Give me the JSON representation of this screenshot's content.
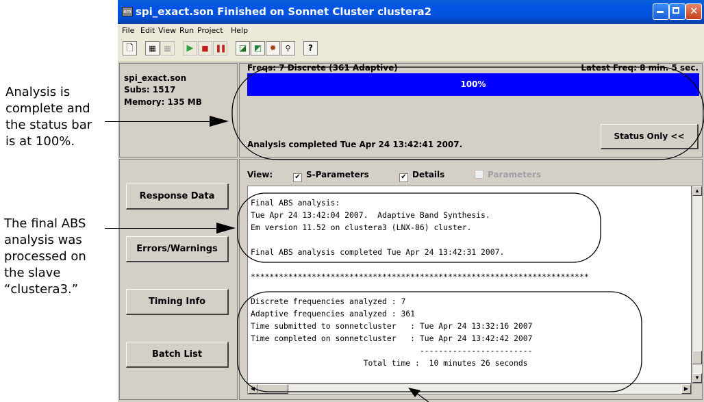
{
  "callouts": {
    "top": [
      "Analysis is",
      "complete and",
      "the status bar",
      "is at 100%."
    ],
    "middle": [
      "The final ABS",
      "analysis was",
      "processed on",
      "the slave",
      "“clustera3.”"
    ]
  },
  "window": {
    "title": "spi_exact.son   Finished on Sonnet Cluster clustera2",
    "app_icon": "em"
  },
  "menu": [
    "File",
    "Edit",
    "View",
    "Run",
    "Project",
    "Help"
  ],
  "toolbar_icons": [
    "new-file-icon",
    "copy-icon",
    "paste-icon",
    "run-icon",
    "stop-icon",
    "pause-icon",
    "plot-icon",
    "current-icon",
    "view-icon",
    "zoom-icon",
    "help-icon"
  ],
  "project": {
    "name": "spi_exact.son",
    "subs": "Subs: 1517",
    "memory": "Memory: 135 MB"
  },
  "status": {
    "freqs": "Freqs:  7 Discrete (361 Adaptive)",
    "latest": "Latest Freq:  8 min. 5 sec.",
    "progress_label": "100%",
    "progress_value": 1.0,
    "completed": "Analysis completed Tue Apr 24 13:42:41 2007.",
    "status_button": "Status Only <<"
  },
  "sidebar": {
    "buttons": [
      "Response Data",
      "Errors/Warnings",
      "Timing Info",
      "Batch List"
    ]
  },
  "view": {
    "label": "View:",
    "options": [
      {
        "label": "S-Parameters",
        "checked": true,
        "enabled": true
      },
      {
        "label": "Details",
        "checked": true,
        "enabled": true
      },
      {
        "label": "Parameters",
        "checked": false,
        "enabled": false
      }
    ]
  },
  "log": [
    "Final ABS analysis:",
    "Tue Apr 24 13:42:04 2007.  Adaptive Band Synthesis.",
    "Em version 11.52 on clustera3 (LNX-86) cluster.",
    "",
    "Final ABS analysis completed Tue Apr 24 13:42:31 2007.",
    "",
    "************************************************************************",
    "",
    "Discrete frequencies analyzed : 7",
    "Adaptive frequencies analyzed : 361",
    "Time submitted to sonnetcluster   : Tue Apr 24 13:32:16 2007",
    "Time completed on sonnetcluster   : Tue Apr 24 13:42:42 2007",
    "                                    ------------------------",
    "                        Total time :  10 minutes 26 seconds"
  ]
}
